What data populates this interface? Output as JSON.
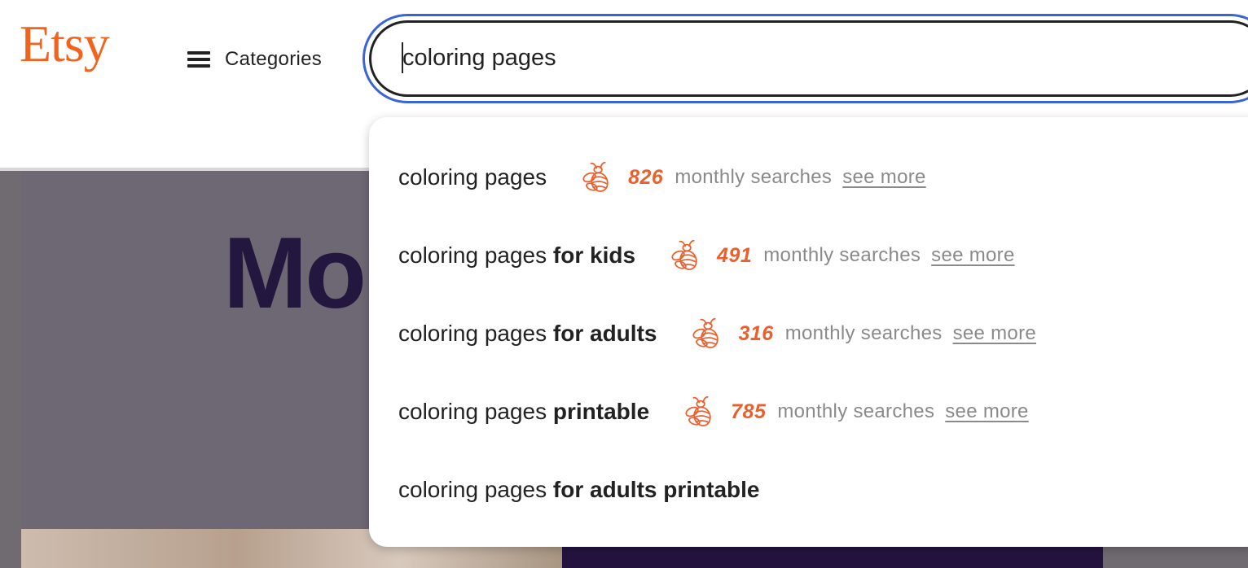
{
  "header": {
    "logo": "Etsy",
    "categories_label": "Categories",
    "search": {
      "value": "coloring pages",
      "placeholder": ""
    }
  },
  "background": {
    "hero_text": "Mo"
  },
  "suggestions": [
    {
      "prefix": "coloring pages",
      "bold": "",
      "count": "826",
      "monthly": "monthly searches",
      "see_more": "see more"
    },
    {
      "prefix": "coloring pages ",
      "bold": "for kids",
      "count": "491",
      "monthly": "monthly searches",
      "see_more": "see more"
    },
    {
      "prefix": "coloring pages ",
      "bold": "for adults",
      "count": "316",
      "monthly": "monthly searches",
      "see_more": "see more"
    },
    {
      "prefix": "coloring pages ",
      "bold": "printable",
      "count": "785",
      "monthly": "monthly searches",
      "see_more": "see more"
    },
    {
      "prefix": "coloring pages ",
      "bold": "for adults printable"
    }
  ],
  "colors": {
    "brand": "#f1641e",
    "focus_ring": "#3b63d9",
    "count": "#ec5f2c",
    "muted": "#8a8a8a"
  },
  "icons": {
    "menu": "hamburger-icon",
    "bee": "bee-icon"
  }
}
